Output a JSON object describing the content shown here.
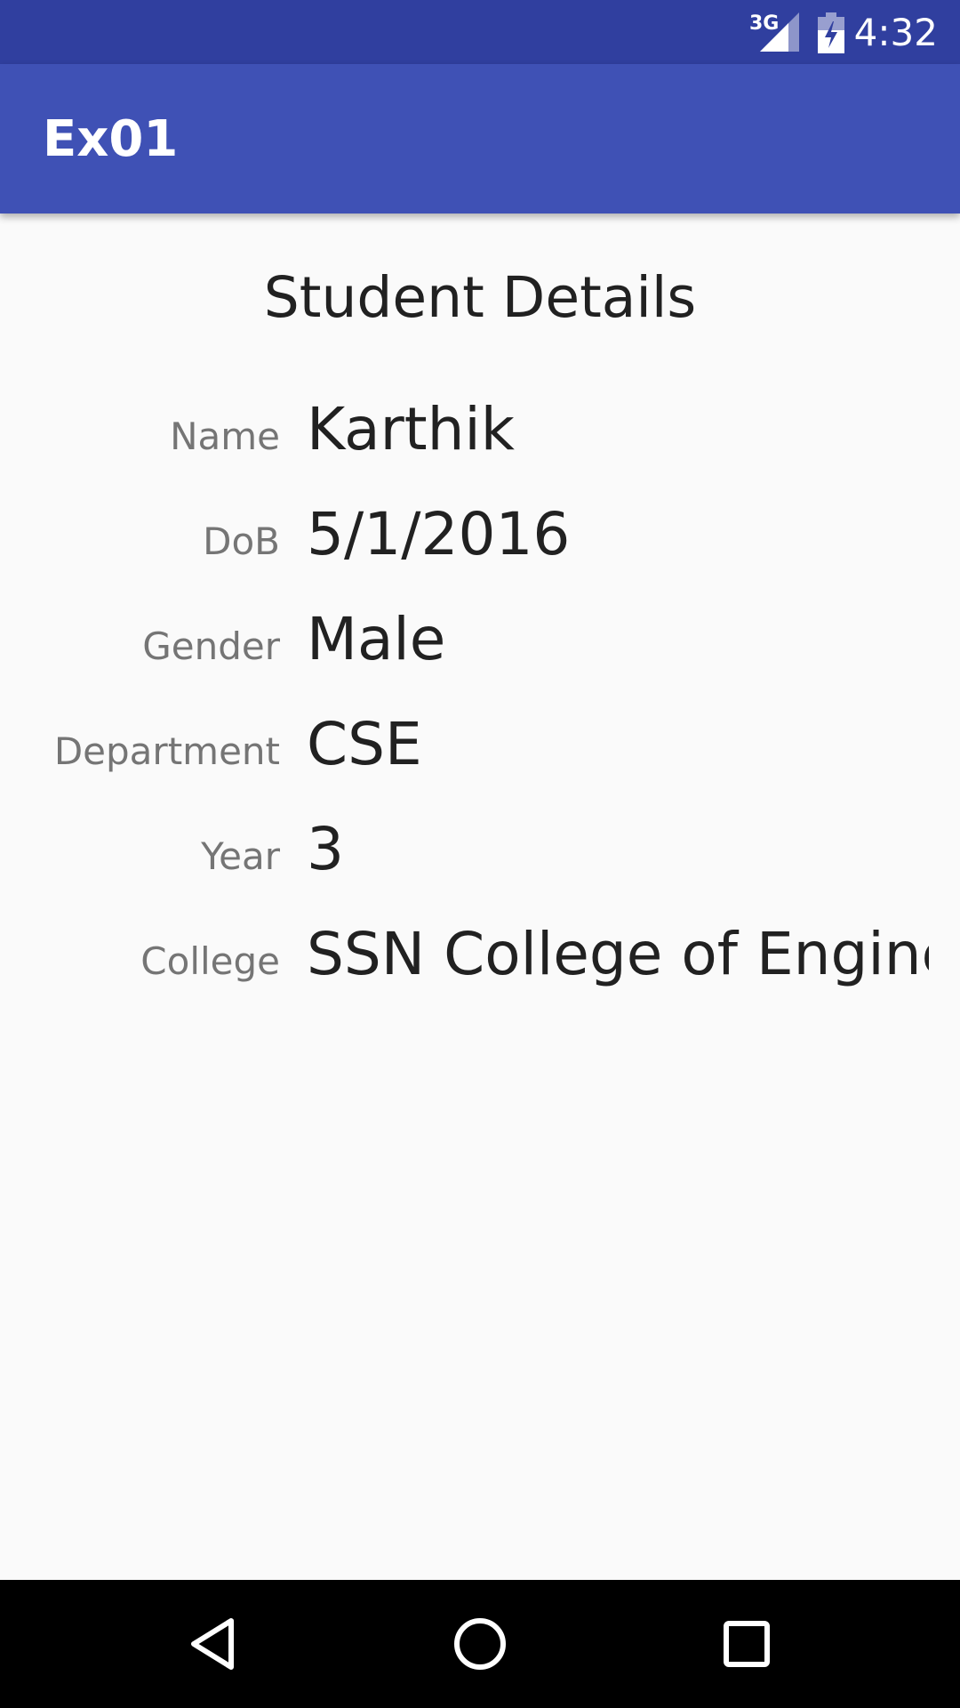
{
  "status_bar": {
    "network": "3G",
    "time": "4:32"
  },
  "app_bar": {
    "title": "Ex01"
  },
  "content": {
    "title": "Student Details",
    "rows": [
      {
        "label": "Name",
        "value": "Karthik"
      },
      {
        "label": "DoB",
        "value": "5/1/2016"
      },
      {
        "label": "Gender",
        "value": "Male"
      },
      {
        "label": "Department",
        "value": "CSE"
      },
      {
        "label": "Year",
        "value": "3"
      },
      {
        "label": "College",
        "value": "SSN College of Enginee"
      }
    ]
  },
  "nav_bar": {
    "buttons": [
      "back-icon",
      "home-icon",
      "recents-icon"
    ]
  },
  "colors": {
    "status_bar": "#303f9f",
    "app_bar": "#3f51b5",
    "background": "#fafafa",
    "label_text": "#757575",
    "value_text": "#212121"
  }
}
